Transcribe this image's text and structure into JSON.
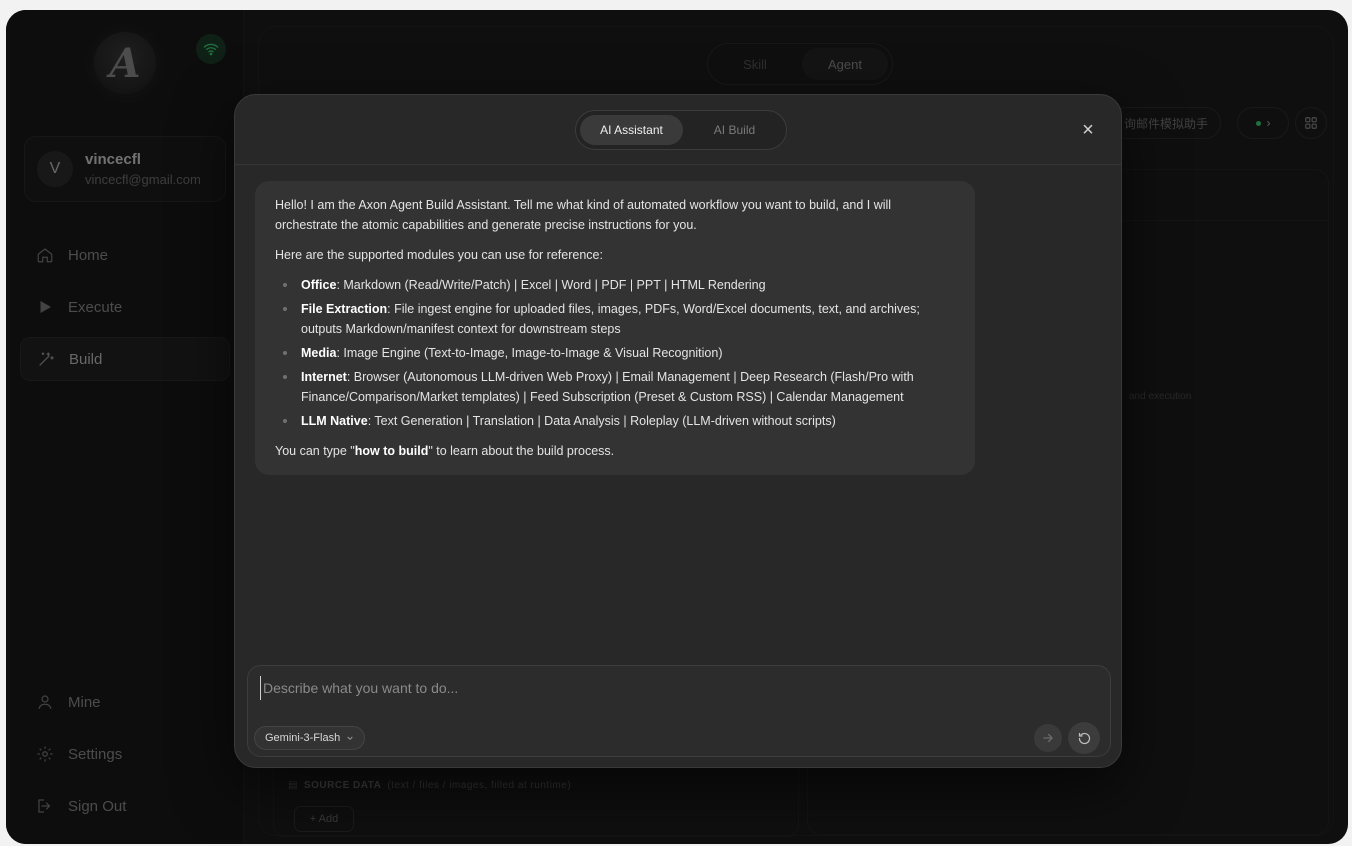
{
  "app": {
    "logo_letter": "A"
  },
  "user": {
    "initial": "V",
    "name": "vincecfl",
    "email": "vincecfl@gmail.com"
  },
  "nav": {
    "home": "Home",
    "execute": "Execute",
    "build": "Build",
    "mine": "Mine",
    "settings": "Settings",
    "sign_out": "Sign Out"
  },
  "top_tabs": {
    "skill": "Skill",
    "agent": "Agent"
  },
  "background": {
    "assistant_pill": "询邮件模拟助手",
    "hint_text": "and execution",
    "source_data_label": "SOURCE DATA",
    "source_data_note": "(text / files / images, filled at runtime)",
    "add_label": "+ Add"
  },
  "modal": {
    "tab_assistant": "AI Assistant",
    "tab_build": "AI Build",
    "close": "×",
    "message": {
      "intro": "Hello! I am the Axon Agent Build Assistant. Tell me what kind of automated workflow you want to build, and I will orchestrate the atomic capabilities and generate precise instructions for you.",
      "modules_intro": "Here are the supported modules you can use for reference:",
      "modules": [
        {
          "name": "Office",
          "desc": ": Markdown (Read/Write/Patch) | Excel | Word | PDF | PPT | HTML Rendering"
        },
        {
          "name": "File Extraction",
          "desc": ": File ingest engine for uploaded files, images, PDFs, Word/Excel documents, text, and archives; outputs Markdown/manifest context for downstream steps"
        },
        {
          "name": "Media",
          "desc": ": Image Engine (Text-to-Image, Image-to-Image & Visual Recognition)"
        },
        {
          "name": "Internet",
          "desc": ": Browser (Autonomous LLM-driven Web Proxy) | Email Management | Deep Research (Flash/Pro with Finance/Comparison/Market templates) | Feed Subscription (Preset & Custom RSS) | Calendar Management"
        },
        {
          "name": "LLM Native",
          "desc": ": Text Generation | Translation | Data Analysis | Roleplay (LLM-driven without scripts)"
        }
      ],
      "outro_prefix": "You can type \"",
      "outro_keyword": "how to build",
      "outro_suffix": "\" to learn about the build process."
    },
    "input": {
      "placeholder": "Describe what you want to do...",
      "value": "",
      "model": "Gemini-3-Flash"
    }
  },
  "icons": {
    "wifi": "wifi-icon",
    "home": "home-icon",
    "execute": "play-icon",
    "build": "magic-wand-icon",
    "mine": "user-icon",
    "settings": "gear-icon",
    "sign_out": "sign-out-icon",
    "send": "arrow-right-icon",
    "reset": "refresh-icon",
    "grid": "grid-icon",
    "chevron": "chevron-down-icon"
  },
  "colors": {
    "accent_green": "#3ccb74",
    "background": "#1c1c1c",
    "modal": "#282828"
  }
}
